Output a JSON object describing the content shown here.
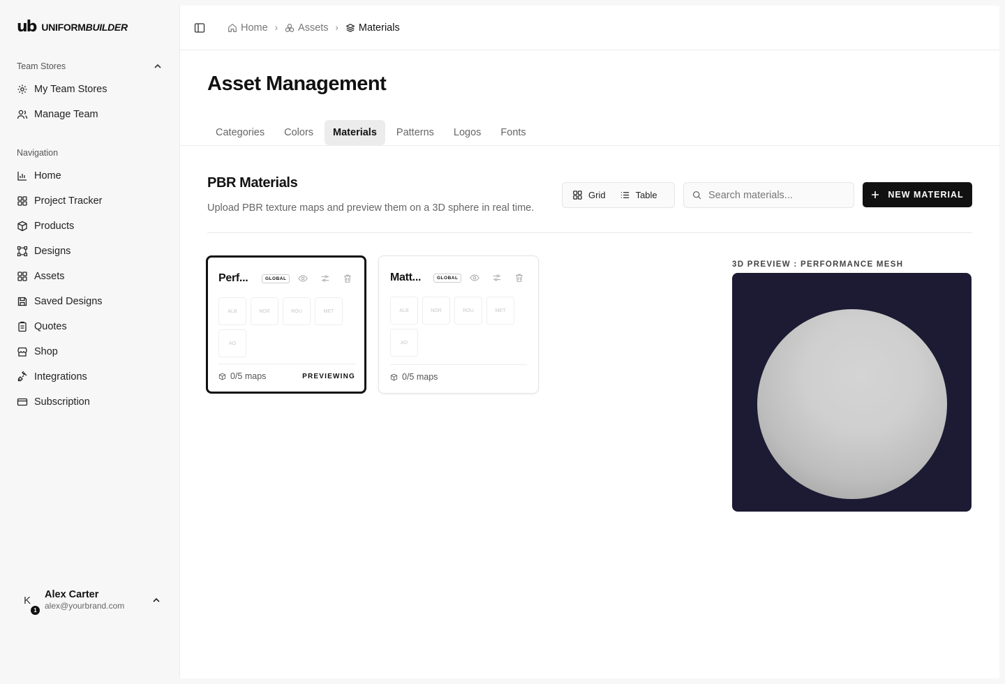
{
  "app": {
    "logo_mark": "ub",
    "logo_text_a": "UNIFORM",
    "logo_text_b": "BUILDER"
  },
  "sidebar": {
    "team_section": "Team Stores",
    "team_items": [
      {
        "label": "My Team Stores",
        "icon": "gear-icon"
      },
      {
        "label": "Manage Team",
        "icon": "users-icon"
      }
    ],
    "nav_section": "Navigation",
    "nav_items": [
      {
        "label": "Home",
        "icon": "bar-chart-icon"
      },
      {
        "label": "Project Tracker",
        "icon": "grid-icon"
      },
      {
        "label": "Products",
        "icon": "box-icon"
      },
      {
        "label": "Designs",
        "icon": "nodes-icon"
      },
      {
        "label": "Assets",
        "icon": "grid-icon"
      },
      {
        "label": "Saved Designs",
        "icon": "save-icon"
      },
      {
        "label": "Quotes",
        "icon": "clipboard-icon"
      },
      {
        "label": "Shop",
        "icon": "store-icon"
      },
      {
        "label": "Integrations",
        "icon": "plug-icon"
      },
      {
        "label": "Subscription",
        "icon": "card-icon"
      }
    ],
    "user": {
      "initial": "K",
      "badge": "1",
      "name": "Alex Carter",
      "email": "alex@yourbrand.com"
    }
  },
  "breadcrumb": [
    {
      "label": "Home",
      "icon": "home-icon"
    },
    {
      "label": "Assets",
      "icon": "assets-icon"
    },
    {
      "label": "Materials",
      "icon": "layers-icon"
    }
  ],
  "page": {
    "title": "Asset Management",
    "tabs": [
      "Categories",
      "Colors",
      "Materials",
      "Patterns",
      "Logos",
      "Fonts"
    ],
    "active_tab": "Materials"
  },
  "section": {
    "title": "PBR Materials",
    "description": "Upload PBR texture maps and preview them on a 3D sphere in real time.",
    "view_grid": "Grid",
    "view_table": "Table",
    "search_placeholder": "Search materials...",
    "new_button": "NEW MATERIAL"
  },
  "materials": [
    {
      "name": "Perf...",
      "badge": "GLOBAL",
      "slots": [
        "ALB",
        "NOR",
        "ROU",
        "MET",
        "AO"
      ],
      "maps": "0/5 maps",
      "status": "PREVIEWING",
      "selected": true
    },
    {
      "name": "Matt...",
      "badge": "GLOBAL",
      "slots": [
        "ALB",
        "NOR",
        "ROU",
        "MET",
        "AO"
      ],
      "maps": "0/5 maps",
      "status": "",
      "selected": false
    }
  ],
  "preview": {
    "label": "3D PREVIEW : PERFORMANCE MESH",
    "background": "#1c1b33",
    "sphere_color": "#cfcfcf"
  }
}
